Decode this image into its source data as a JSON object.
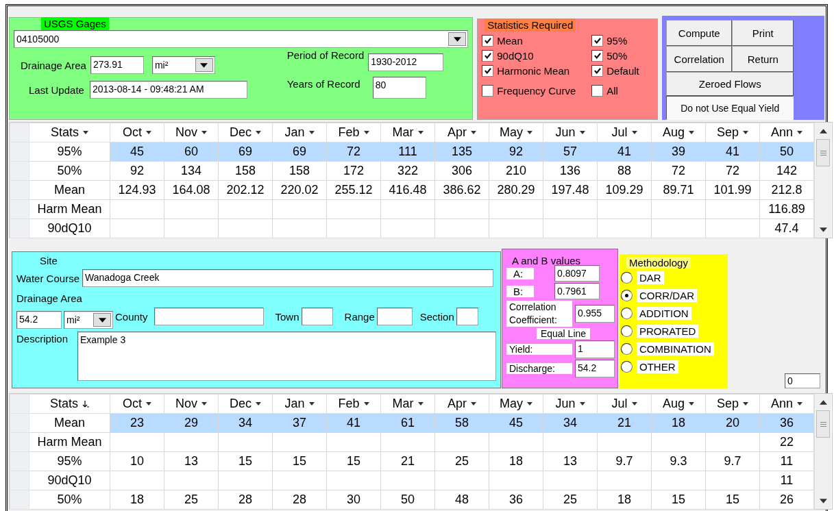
{
  "gages": {
    "title": "USGS Gages",
    "station": "04105000",
    "drainage_area_label": "Drainage Area",
    "drainage_area": "273.91",
    "area_unit": "mi²",
    "last_update_label": "Last Update",
    "last_update": "2013-08-14 - 09:48:21 AM",
    "period_label": "Period of Record",
    "period": "1930-2012",
    "years_label": "Years of Record",
    "years": "80"
  },
  "statistics": {
    "title": "Statistics Required",
    "options": [
      {
        "label": "Mean",
        "checked": true
      },
      {
        "label": "95%",
        "checked": true
      },
      {
        "label": "90dQ10",
        "checked": true
      },
      {
        "label": "50%",
        "checked": true
      },
      {
        "label": "Harmonic Mean",
        "checked": true
      },
      {
        "label": "Default",
        "checked": true
      },
      {
        "label": "Frequency Curve",
        "checked": false
      },
      {
        "label": "All",
        "checked": false
      }
    ]
  },
  "actions": [
    {
      "label": "Compute",
      "kind": "button",
      "pressed": false
    },
    {
      "label": "Print",
      "kind": "button",
      "pressed": false
    },
    {
      "label": "Correlation",
      "kind": "button",
      "pressed": false
    },
    {
      "label": "Return",
      "kind": "button",
      "pressed": false
    },
    {
      "label": "Zeroed Flows",
      "kind": "wide",
      "pressed": false
    },
    {
      "label": "Do not Use Equal Yield",
      "kind": "wide",
      "pressed": true
    }
  ],
  "grid_1": {
    "columns": [
      {
        "label": "Stats",
        "sorted": false
      },
      {
        "label": "Oct",
        "sorted": false
      },
      {
        "label": "Nov",
        "sorted": false
      },
      {
        "label": "Dec",
        "sorted": false
      },
      {
        "label": "Jan",
        "sorted": false
      },
      {
        "label": "Feb",
        "sorted": false
      },
      {
        "label": "Mar",
        "sorted": false
      },
      {
        "label": "Apr",
        "sorted": false
      },
      {
        "label": "May",
        "sorted": false
      },
      {
        "label": "Jun",
        "sorted": false
      },
      {
        "label": "Jul",
        "sorted": false
      },
      {
        "label": "Aug",
        "sorted": false
      },
      {
        "label": "Sep",
        "sorted": false
      },
      {
        "label": "Ann",
        "sorted": false
      }
    ],
    "rows": [
      {
        "selected": true,
        "cells": [
          "95%",
          "45",
          "60",
          "69",
          "69",
          "72",
          "111",
          "135",
          "92",
          "57",
          "41",
          "39",
          "41",
          "50"
        ]
      },
      {
        "selected": false,
        "cells": [
          "50%",
          "92",
          "134",
          "158",
          "158",
          "172",
          "322",
          "306",
          "210",
          "136",
          "88",
          "72",
          "72",
          "142"
        ]
      },
      {
        "selected": false,
        "cells": [
          "Mean",
          "124.93",
          "164.08",
          "202.12",
          "220.02",
          "255.12",
          "416.48",
          "386.62",
          "280.29",
          "197.48",
          "109.29",
          "89.71",
          "101.99",
          "212.8"
        ]
      },
      {
        "selected": false,
        "cells": [
          "Harm Mean",
          "",
          "",
          "",
          "",
          "",
          "",
          "",
          "",
          "",
          "",
          "",
          "",
          "116.89"
        ]
      },
      {
        "selected": false,
        "cells": [
          "90dQ10",
          "",
          "",
          "",
          "",
          "",
          "",
          "",
          "",
          "",
          "",
          "",
          "",
          "47.4"
        ]
      }
    ]
  },
  "site": {
    "title": "Site",
    "water_course_label": "Water Course",
    "water_course": "Wanadoga Creek",
    "drainage_area_label": "Drainage Area",
    "drainage_area": "54.2",
    "area_unit": "mi²",
    "county_label": "County",
    "town_label": "Town",
    "range_label": "Range",
    "section_label": "Section",
    "description_label": "Description",
    "description": "Example 3"
  },
  "ab_values": {
    "title": "A and B values",
    "a_label": "A:",
    "a": "0.8097",
    "b_label": "B:",
    "b": "0.7961",
    "correlation_label": "Correlation Coefficient:",
    "correlation": "0.955",
    "equal_line_label": "Equal Line",
    "yield_label": "Yield:",
    "yield": "1",
    "discharge_label": "Discharge:",
    "discharge": "54.2"
  },
  "methodology": {
    "title": "Methodology",
    "options": [
      {
        "label": "DAR",
        "selected": false
      },
      {
        "label": "CORR/DAR",
        "selected": true
      },
      {
        "label": "ADDITION",
        "selected": false
      },
      {
        "label": "PRORATED",
        "selected": false
      },
      {
        "label": "COMBINATION",
        "selected": false
      },
      {
        "label": "OTHER",
        "selected": false
      }
    ]
  },
  "counter": "0",
  "grid_2": {
    "columns": [
      {
        "label": "Stats",
        "sorted": true
      },
      {
        "label": "Oct",
        "sorted": false
      },
      {
        "label": "Nov",
        "sorted": false
      },
      {
        "label": "Dec",
        "sorted": false
      },
      {
        "label": "Jan",
        "sorted": false
      },
      {
        "label": "Feb",
        "sorted": false
      },
      {
        "label": "Mar",
        "sorted": false
      },
      {
        "label": "Apr",
        "sorted": false
      },
      {
        "label": "May",
        "sorted": false
      },
      {
        "label": "Jun",
        "sorted": false
      },
      {
        "label": "Jul",
        "sorted": false
      },
      {
        "label": "Aug",
        "sorted": false
      },
      {
        "label": "Sep",
        "sorted": false
      },
      {
        "label": "Ann",
        "sorted": false
      }
    ],
    "rows": [
      {
        "selected": true,
        "cells": [
          "Mean",
          "23",
          "29",
          "34",
          "37",
          "41",
          "61",
          "58",
          "45",
          "34",
          "21",
          "18",
          "20",
          "36"
        ]
      },
      {
        "selected": false,
        "cells": [
          "Harm Mean",
          "",
          "",
          "",
          "",
          "",
          "",
          "",
          "",
          "",
          "",
          "",
          "",
          "22"
        ]
      },
      {
        "selected": false,
        "cells": [
          "95%",
          "10",
          "13",
          "15",
          "15",
          "15",
          "21",
          "25",
          "18",
          "13",
          "9.7",
          "9.3",
          "9.7",
          "11"
        ]
      },
      {
        "selected": false,
        "cells": [
          "90dQ10",
          "",
          "",
          "",
          "",
          "",
          "",
          "",
          "",
          "",
          "",
          "",
          "",
          "11"
        ]
      },
      {
        "selected": false,
        "cells": [
          "50%",
          "18",
          "25",
          "28",
          "28",
          "30",
          "50",
          "48",
          "36",
          "25",
          "18",
          "15",
          "15",
          "26"
        ]
      }
    ]
  }
}
